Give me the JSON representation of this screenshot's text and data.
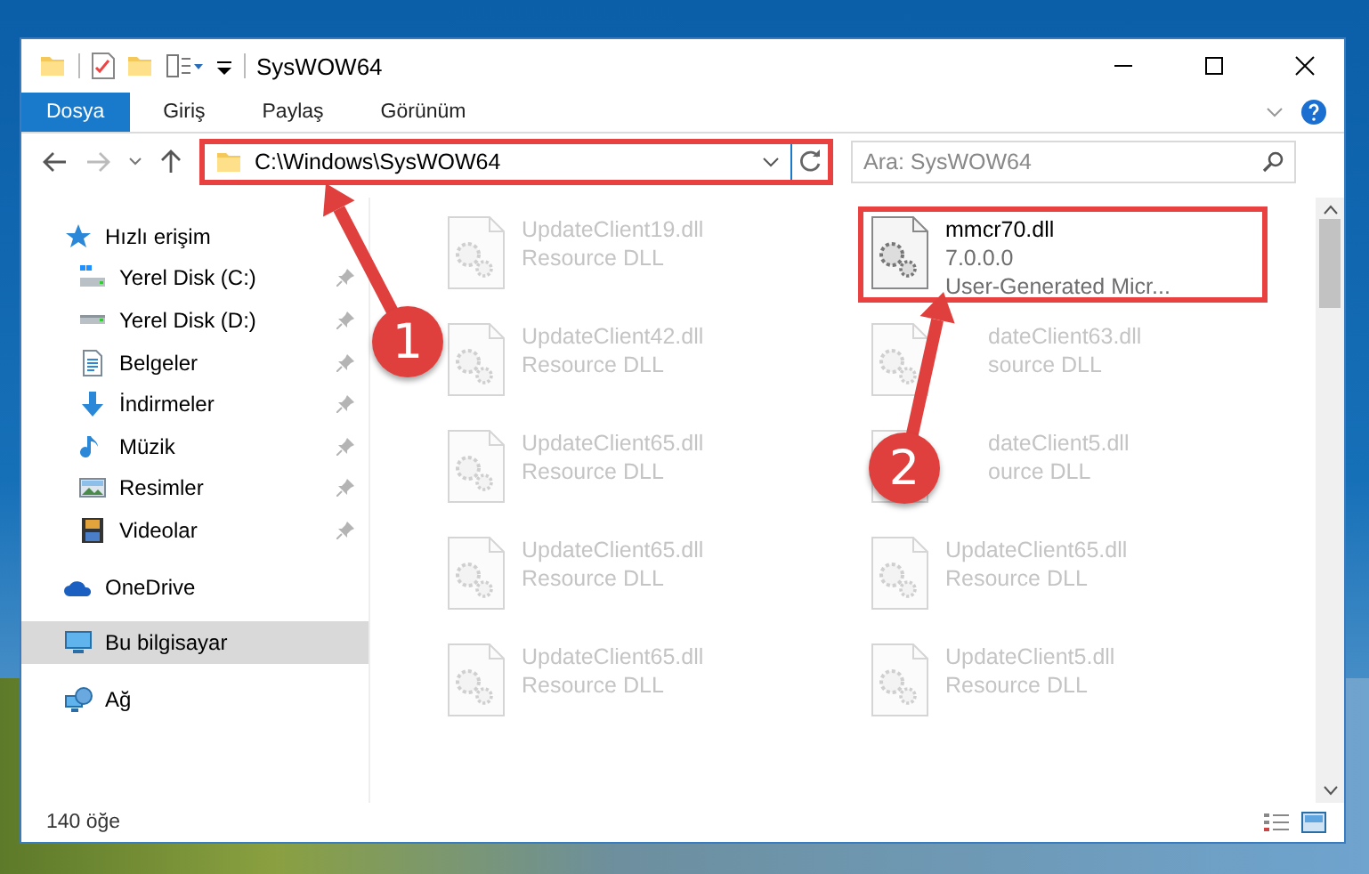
{
  "window": {
    "title": "SysWOW64"
  },
  "ribbon_tabs": [
    {
      "label": "Dosya",
      "selected": true
    },
    {
      "label": "Giriş",
      "selected": false
    },
    {
      "label": "Paylaş",
      "selected": false
    },
    {
      "label": "Görünüm",
      "selected": false
    }
  ],
  "address": {
    "path": "C:\\Windows\\SysWOW64",
    "highlighted": true
  },
  "search": {
    "placeholder": "Ara: SysWOW64"
  },
  "sidebar": {
    "items": [
      {
        "label": "Hızlı erişim",
        "kind": "star",
        "selected": false,
        "children": [
          {
            "label": "Yerel Disk (C:)",
            "kind": "system-drive",
            "pinned": true,
            "selected": false
          },
          {
            "label": "Yerel Disk (D:)",
            "kind": "drive",
            "pinned": true,
            "selected": false
          },
          {
            "label": "Belgeler",
            "kind": "document",
            "pinned": true,
            "selected": false
          },
          {
            "label": "İndirmeler",
            "kind": "download",
            "pinned": true,
            "selected": false
          },
          {
            "label": "Müzik",
            "kind": "music",
            "pinned": true,
            "selected": false
          },
          {
            "label": "Resimler",
            "kind": "picture",
            "pinned": true,
            "selected": false
          },
          {
            "label": "Videolar",
            "kind": "video",
            "pinned": true,
            "selected": false
          }
        ]
      },
      {
        "label": "OneDrive",
        "kind": "cloud",
        "selected": false
      },
      {
        "label": "Bu bilgisayar",
        "kind": "computer",
        "selected": true
      },
      {
        "label": "Ağ",
        "kind": "network",
        "selected": false
      }
    ]
  },
  "files": [
    {
      "name": "UpdateClient19.dll",
      "details": [
        "Resource DLL"
      ],
      "blurred": true,
      "highlighted": false
    },
    {
      "name": "mmcr70.dll",
      "details": [
        "7.0.0.0",
        "User-Generated Micr..."
      ],
      "blurred": false,
      "highlighted": true
    },
    {
      "name": "UpdateClient42.dll",
      "details": [
        "Resource DLL"
      ],
      "blurred": true,
      "highlighted": false
    },
    {
      "name": "dateClient63.dll",
      "details": [
        "source DLL"
      ],
      "blurred": true,
      "highlighted": false,
      "covered_by_callout": true
    },
    {
      "name": "UpdateClient65.dll",
      "details": [
        "Resource DLL"
      ],
      "blurred": true,
      "highlighted": false
    },
    {
      "name": "dateClient5.dll",
      "details": [
        "ource DLL"
      ],
      "blurred": true,
      "highlighted": false,
      "covered_by_callout": true
    },
    {
      "name": "UpdateClient65.dll",
      "details": [
        "Resource DLL"
      ],
      "blurred": true,
      "highlighted": false
    },
    {
      "name": "UpdateClient65.dll",
      "details": [
        "Resource DLL"
      ],
      "blurred": true,
      "highlighted": false
    },
    {
      "name": "UpdateClient65.dll",
      "details": [
        "Resource DLL"
      ],
      "blurred": true,
      "highlighted": false
    },
    {
      "name": "UpdateClient5.dll",
      "details": [
        "Resource DLL"
      ],
      "blurred": true,
      "highlighted": false
    }
  ],
  "status_bar": {
    "item_count": "140 öğe"
  },
  "callouts": [
    {
      "number": "1"
    },
    {
      "number": "2"
    }
  ]
}
